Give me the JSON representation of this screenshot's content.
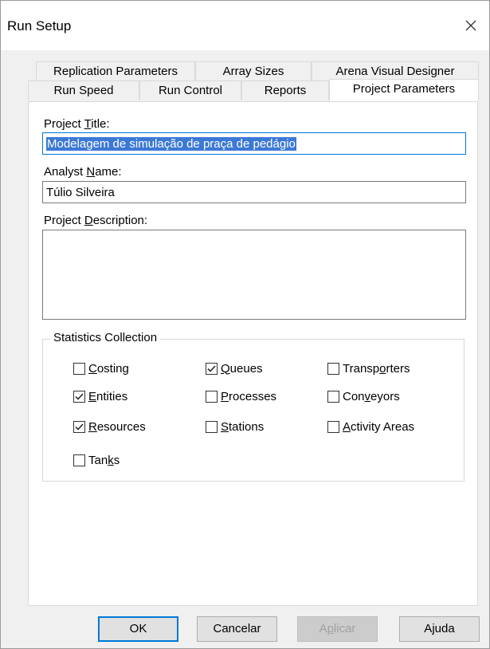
{
  "window": {
    "title": "Run Setup",
    "close_glyph": "close-icon"
  },
  "tabs": {
    "row1": [
      "Replication Parameters",
      "Array Sizes",
      "Arena Visual Designer"
    ],
    "row2": [
      "Run Speed",
      "Run Control",
      "Reports",
      "Project Parameters"
    ],
    "active": "Project Parameters"
  },
  "form": {
    "project_title_label": "Project Title:",
    "project_title_value": "Modelagem de simulação de praça de pedágio",
    "analyst_name_label": "Analyst Name:",
    "analyst_name_value": "Túlio Silveira",
    "project_description_label": "Project Description:",
    "project_description_value": ""
  },
  "statistics": {
    "title": "Statistics Collection",
    "items": [
      {
        "label": "Costing",
        "checked": false
      },
      {
        "label": "Queues",
        "checked": true
      },
      {
        "label": "Transporters",
        "checked": false
      },
      {
        "label": "Entities",
        "checked": true
      },
      {
        "label": "Processes",
        "checked": false
      },
      {
        "label": "Conveyors",
        "checked": false
      },
      {
        "label": "Resources",
        "checked": true
      },
      {
        "label": "Stations",
        "checked": false
      },
      {
        "label": "Activity Areas",
        "checked": false
      },
      {
        "label": "Tanks",
        "checked": false
      }
    ]
  },
  "buttons": {
    "ok": "OK",
    "cancel": "Cancelar",
    "apply": "Aplicar",
    "help": "Ajuda"
  },
  "colors": {
    "selection": "#3c79d6",
    "focus_border": "#0078d7",
    "dialog_bg": "#f0f0f0"
  }
}
